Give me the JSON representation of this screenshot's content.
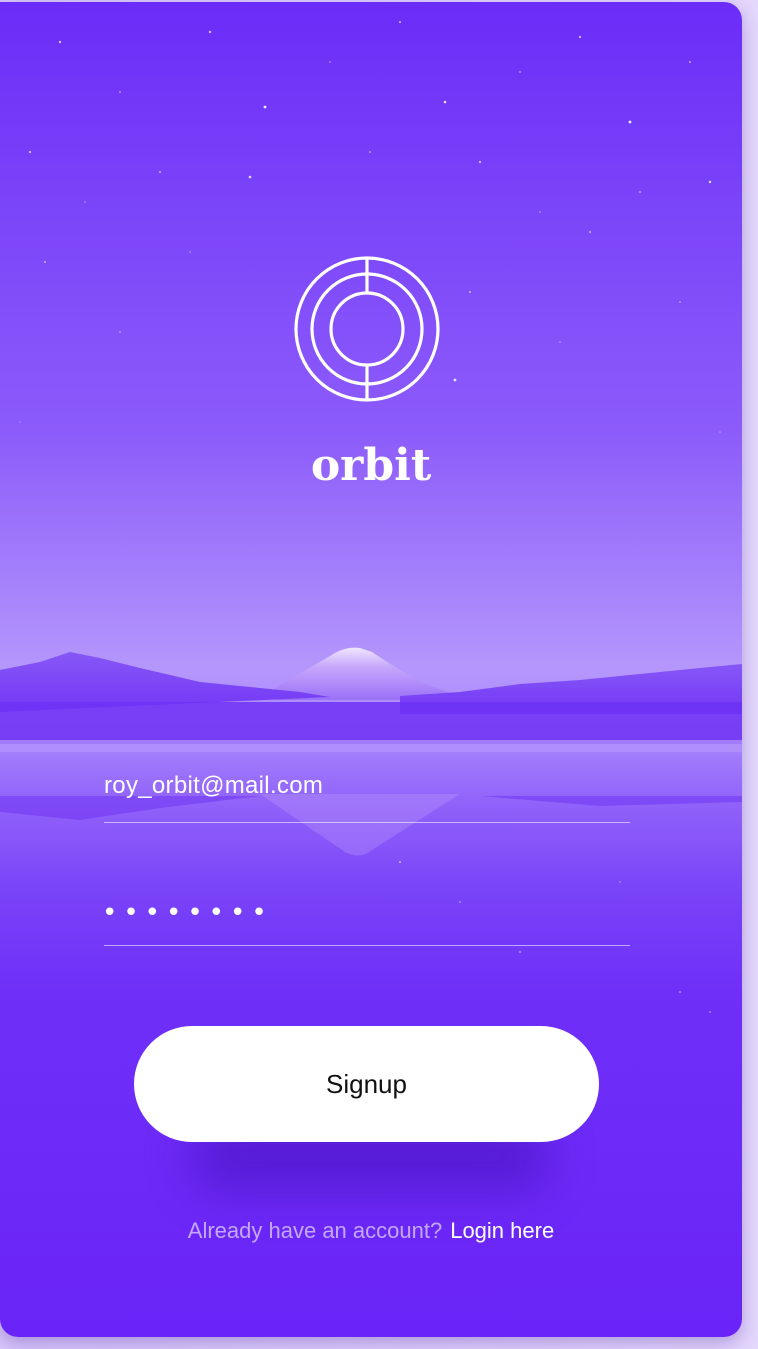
{
  "app": {
    "brand_name": "orbit",
    "logo_icon": "orbit-logo-icon"
  },
  "form": {
    "email_value": "roy_orbit@mail.com",
    "password_value": "••••••••"
  },
  "actions": {
    "signup_label": "Signup"
  },
  "footer": {
    "prompt_text": "Already have an account?",
    "login_link": "Login here"
  },
  "colors": {
    "accent": "#6a24f7",
    "button_bg": "#ffffff",
    "button_text": "#111111"
  }
}
